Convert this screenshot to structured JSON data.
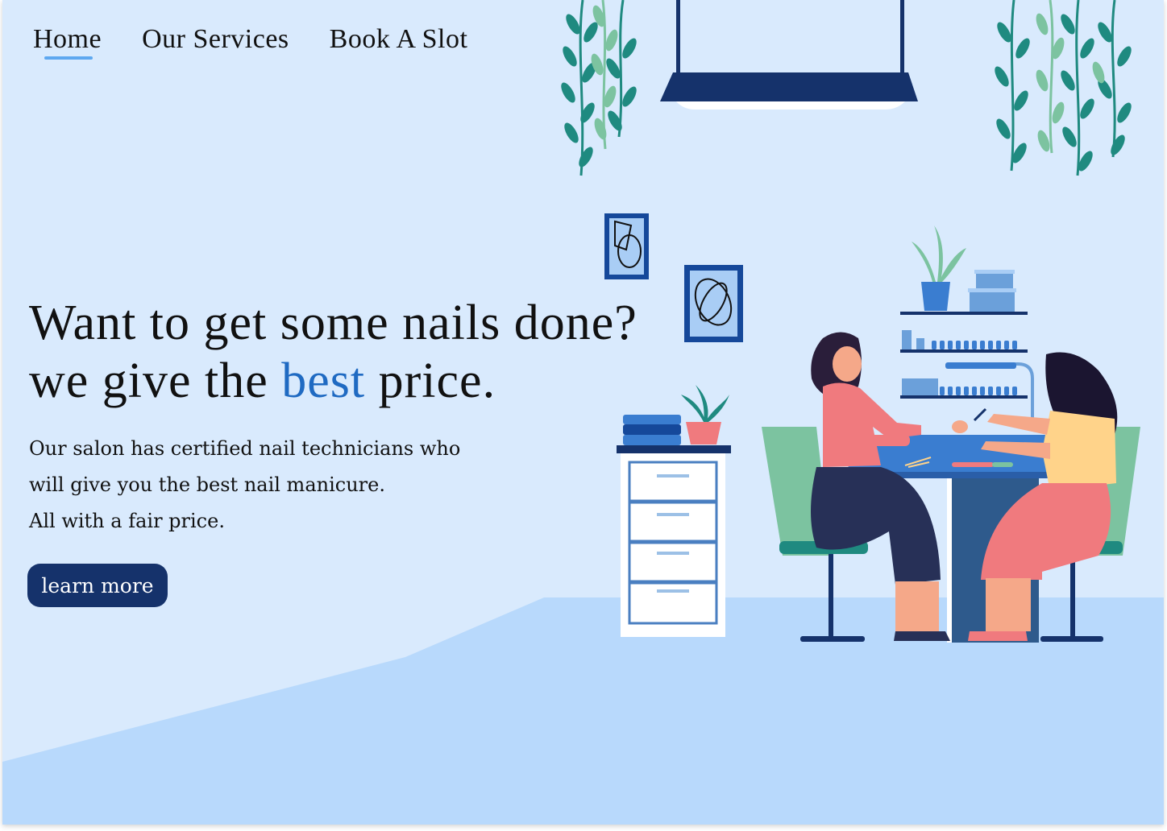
{
  "nav": {
    "items": [
      {
        "label": "Home",
        "active": true
      },
      {
        "label": "Our Services",
        "active": false
      },
      {
        "label": "Book A Slot",
        "active": false
      }
    ]
  },
  "hero": {
    "line1": "Want to get some nails done?",
    "line2_pre": "we give the ",
    "line2_accent": "best",
    "line2_post": " price.",
    "desc_lines": [
      "Our salon has certified nail technicians who",
      "will give you the best nail manicure.",
      "All with a fair price."
    ],
    "cta_label": "learn more"
  },
  "colors": {
    "background": "#d9eafd",
    "floor": "#b8d9fc",
    "accent": "#1f6ac2",
    "button": "#15326b",
    "nav_underline": "#5ea8f0"
  },
  "illustration": {
    "subject": "nail-salon-illustration"
  }
}
